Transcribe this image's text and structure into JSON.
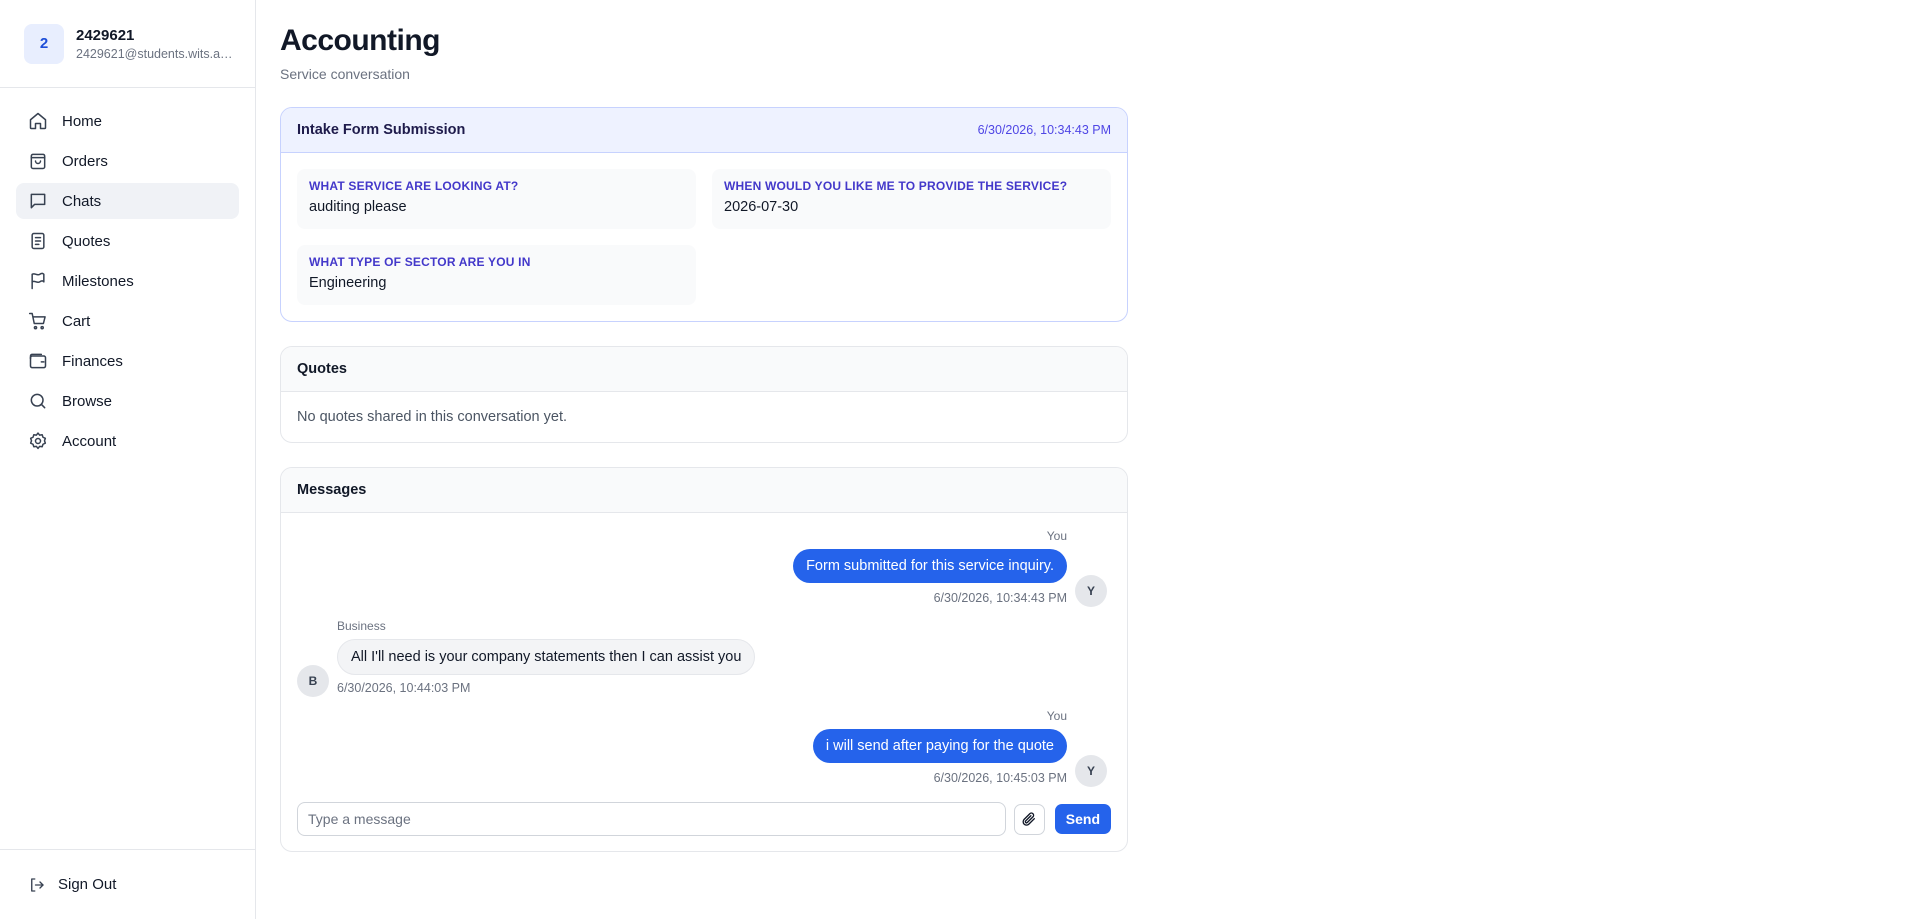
{
  "user": {
    "avatar_initial": "2",
    "name": "2429621",
    "email": "2429621@students.wits.ac.za"
  },
  "nav": {
    "items": [
      {
        "label": "Home",
        "icon": "home-icon"
      },
      {
        "label": "Orders",
        "icon": "shopping-bag-icon"
      },
      {
        "label": "Chats",
        "icon": "chat-icon",
        "active": true
      },
      {
        "label": "Quotes",
        "icon": "document-icon"
      },
      {
        "label": "Milestones",
        "icon": "flag-icon"
      },
      {
        "label": "Cart",
        "icon": "cart-icon"
      },
      {
        "label": "Finances",
        "icon": "wallet-icon"
      },
      {
        "label": "Browse",
        "icon": "search-icon"
      },
      {
        "label": "Account",
        "icon": "gear-icon"
      }
    ],
    "sign_out": "Sign Out"
  },
  "page": {
    "title": "Accounting",
    "subtitle": "Service conversation"
  },
  "intake": {
    "title": "Intake Form Submission",
    "timestamp": "6/30/2026, 10:34:43 PM",
    "fields": [
      {
        "label": "What service are looking at?",
        "value": "auditing please"
      },
      {
        "label": "When would you like me to provide the service?",
        "value": "2026-07-30"
      },
      {
        "label": "What type of sector are you in",
        "value": "Engineering"
      }
    ]
  },
  "quotes": {
    "title": "Quotes",
    "empty_text": "No quotes shared in this conversation yet."
  },
  "messages": {
    "title": "Messages",
    "items": [
      {
        "sender": "You",
        "text": "Form submitted for this service inquiry.",
        "time": "6/30/2026, 10:34:43 PM",
        "avatar": "Y",
        "direction": "out"
      },
      {
        "sender": "Business",
        "text": "All I'll need is your company statements then I can assist you",
        "time": "6/30/2026, 10:44:03 PM",
        "avatar": "B",
        "direction": "in"
      },
      {
        "sender": "You",
        "text": "i will send after paying for the quote",
        "time": "6/30/2026, 10:45:03 PM",
        "avatar": "Y",
        "direction": "out"
      }
    ],
    "composer": {
      "placeholder": "Type a message",
      "send_label": "Send"
    }
  },
  "colors": {
    "accent": "#2563eb",
    "intake_accent": "#4338ca"
  }
}
